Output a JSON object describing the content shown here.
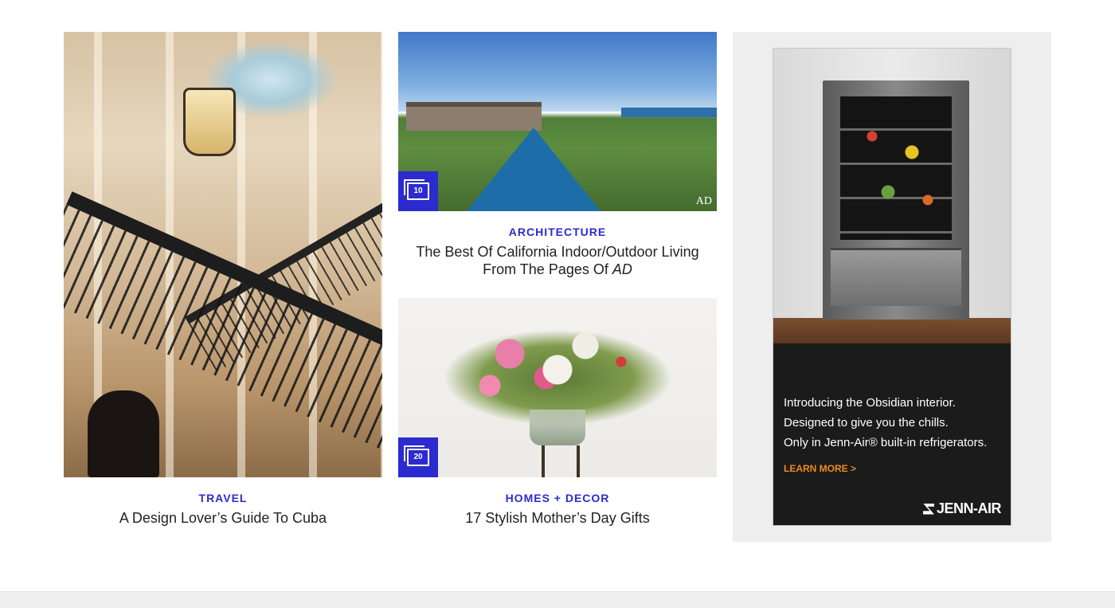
{
  "cards": [
    {
      "category": "TRAVEL",
      "headline": "A Design Lover’s Guide To Cuba",
      "image_alt": "staircase-photo"
    },
    {
      "category": "ARCHITECTURE",
      "headline_line1": "The Best Of California Indoor/Outdoor Living",
      "headline_line2_prefix": "From The Pages Of ",
      "headline_line2_mag": "AD",
      "gallery_count": "10",
      "image_watermark": "AD",
      "image_alt": "pool-photo"
    },
    {
      "category": "HOMES + DECOR",
      "headline": "17 Stylish Mother’s Day Gifts",
      "gallery_count": "20",
      "image_alt": "flowers-photo"
    }
  ],
  "ad": {
    "line1": "Introducing the Obsidian interior.",
    "line2": "Designed to give you the chills.",
    "line3": "Only in Jenn-Air® built-in refrigerators.",
    "cta": "LEARN MORE >",
    "brand": "JENN-AIR"
  },
  "colors": {
    "accent": "#2b2bd0",
    "ad_cta": "#f08a1c",
    "ad_panel_bg": "#eeeeee"
  }
}
